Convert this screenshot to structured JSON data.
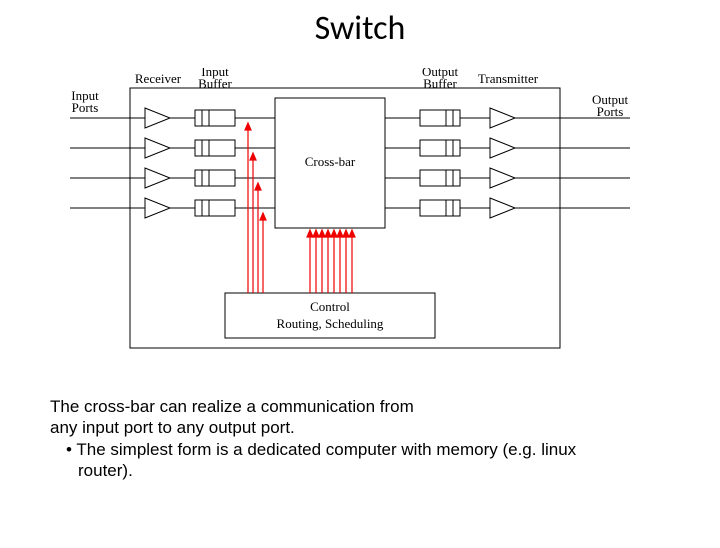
{
  "title": "Switch",
  "labels": {
    "input_ports": "Input\nPorts",
    "receiver": "Receiver",
    "input_buffer": "Input\nBuffer",
    "crossbar": "Cross-bar",
    "output_buffer": "Output\nBuffer",
    "transmitter": "Transmitter",
    "output_ports": "Output\nPorts",
    "control_l1": "Control",
    "control_l2": "Routing, Scheduling"
  },
  "caption": {
    "line1": "The cross-bar can realize a communication from",
    "line2": "any input port to any output port.",
    "bullet": "• The simplest form is a dedicated computer with memory (e.g. linux router)."
  },
  "diagram_data": {
    "num_input_ports": 4,
    "num_output_ports": 4,
    "components_left_to_right": [
      "Receiver",
      "Input Buffer",
      "Cross-bar",
      "Output Buffer",
      "Transmitter"
    ],
    "control_block": "Control — Routing, Scheduling",
    "control_arrows_to": [
      "Input Buffers",
      "Cross-bar"
    ]
  }
}
